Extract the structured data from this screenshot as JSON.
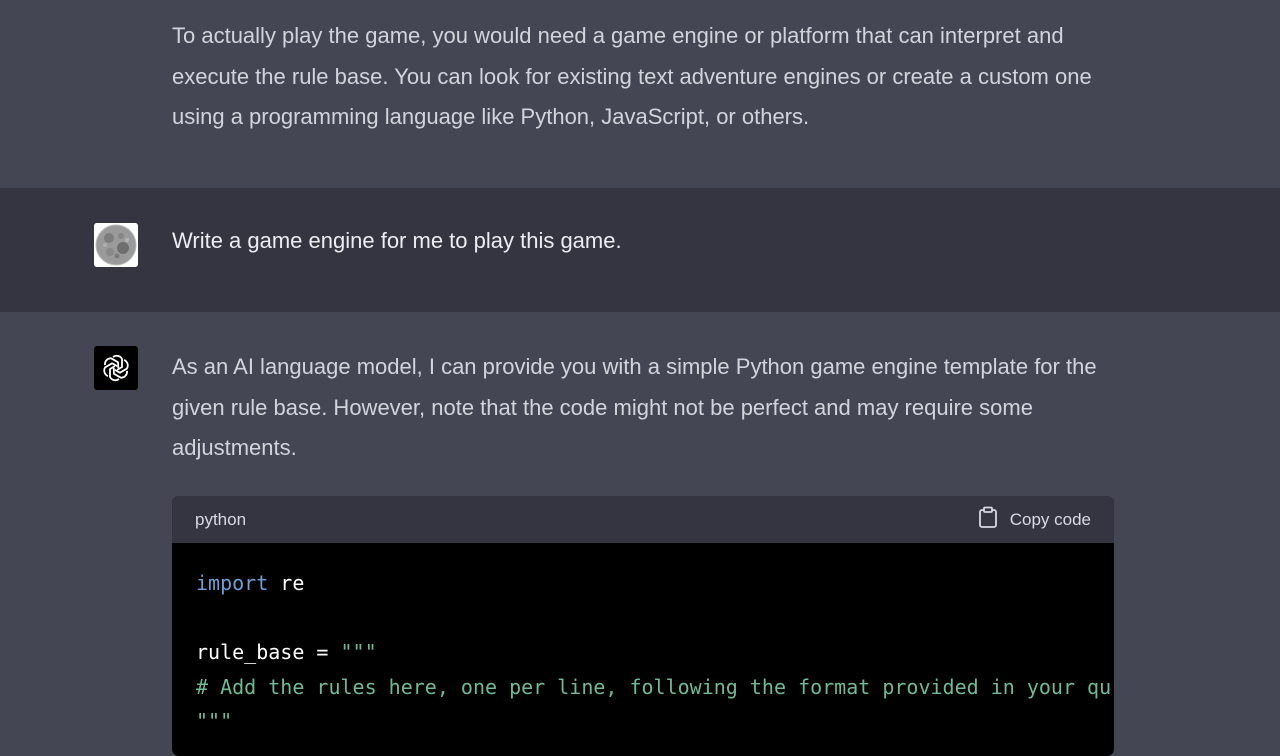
{
  "previous_message": {
    "text": "To actually play the game, you would need a game engine or platform that can interpret and execute the rule base. You can look for existing text adventure engines or create a custom one using a programming language like Python, JavaScript, or others."
  },
  "user_message": {
    "avatar_icon": "moon-avatar-icon",
    "text": "Write a game engine for me to play this game."
  },
  "assistant_message": {
    "avatar_icon": "openai-logo-icon",
    "text": "As an AI language model, I can provide you with a simple Python game engine template for the given rule base. However, note that the code might not be perfect and may require some adjustments.",
    "code_block": {
      "language": "python",
      "copy_label": "Copy code",
      "copy_icon": "clipboard-icon",
      "lines": {
        "line1_kw": "import",
        "line1_rest": " re",
        "line3_rest": "rule_base = ",
        "line3_str": "\"\"\"",
        "line4_comment": "# Add the rules here, one per line, following the format provided in your qu",
        "line5_str": "\"\"\""
      },
      "colors": {
        "keyword": "#6e9ed4",
        "string": "#6fb995",
        "background": "#000000",
        "header": "#343541"
      }
    }
  },
  "colors": {
    "assistant_bg": "#444654",
    "user_bg": "#343541",
    "text": "#d1d5db"
  }
}
